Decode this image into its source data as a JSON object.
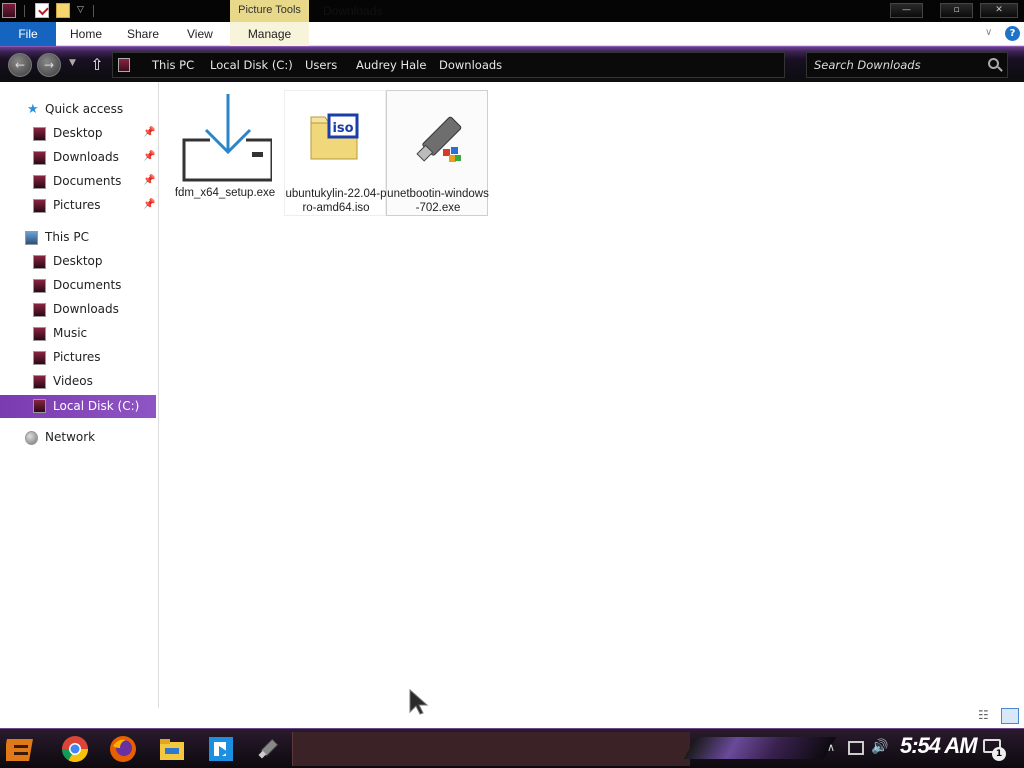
{
  "titlebar": {
    "contextual_tab": "Picture Tools",
    "title": "Downloads",
    "minimize": "—",
    "maximize": "▫",
    "close": "✕"
  },
  "ribbon": {
    "tabs": [
      {
        "label": "File"
      },
      {
        "label": "Home"
      },
      {
        "label": "Share"
      },
      {
        "label": "View"
      },
      {
        "label": "Manage"
      }
    ]
  },
  "address": {
    "breadcrumbs": [
      "This PC",
      "Local Disk (C:)",
      "Users",
      "Audrey Hale",
      "Downloads"
    ],
    "search_placeholder": "Search Downloads"
  },
  "nav": {
    "quick_access": "Quick access",
    "quick_items": [
      {
        "label": "Desktop",
        "icon": "desktop-icon"
      },
      {
        "label": "Downloads",
        "icon": "downloads-icon"
      },
      {
        "label": "Documents",
        "icon": "documents-icon"
      },
      {
        "label": "Pictures",
        "icon": "pictures-icon"
      }
    ],
    "this_pc": "This PC",
    "pc_items": [
      {
        "label": "Desktop"
      },
      {
        "label": "Documents"
      },
      {
        "label": "Downloads"
      },
      {
        "label": "Music"
      },
      {
        "label": "Pictures"
      },
      {
        "label": "Videos"
      },
      {
        "label": "Local Disk (C:)"
      }
    ],
    "network": "Network"
  },
  "files": [
    {
      "name": "fdm_x64_setup.exe",
      "icon": "download-arrow-icon"
    },
    {
      "name": "ubuntukylin-22.04-pro-amd64.iso",
      "icon": "iso-file-icon"
    },
    {
      "name": "unetbootin-windows-702.exe",
      "icon": "usb-drive-icon"
    }
  ],
  "taskbar": {
    "clock": "5:54 AM",
    "notification_count": "1",
    "icons": [
      "start-icon",
      "chrome-icon",
      "firefox-icon",
      "file-explorer-icon",
      "app-icon",
      "unetbootin-icon"
    ]
  }
}
